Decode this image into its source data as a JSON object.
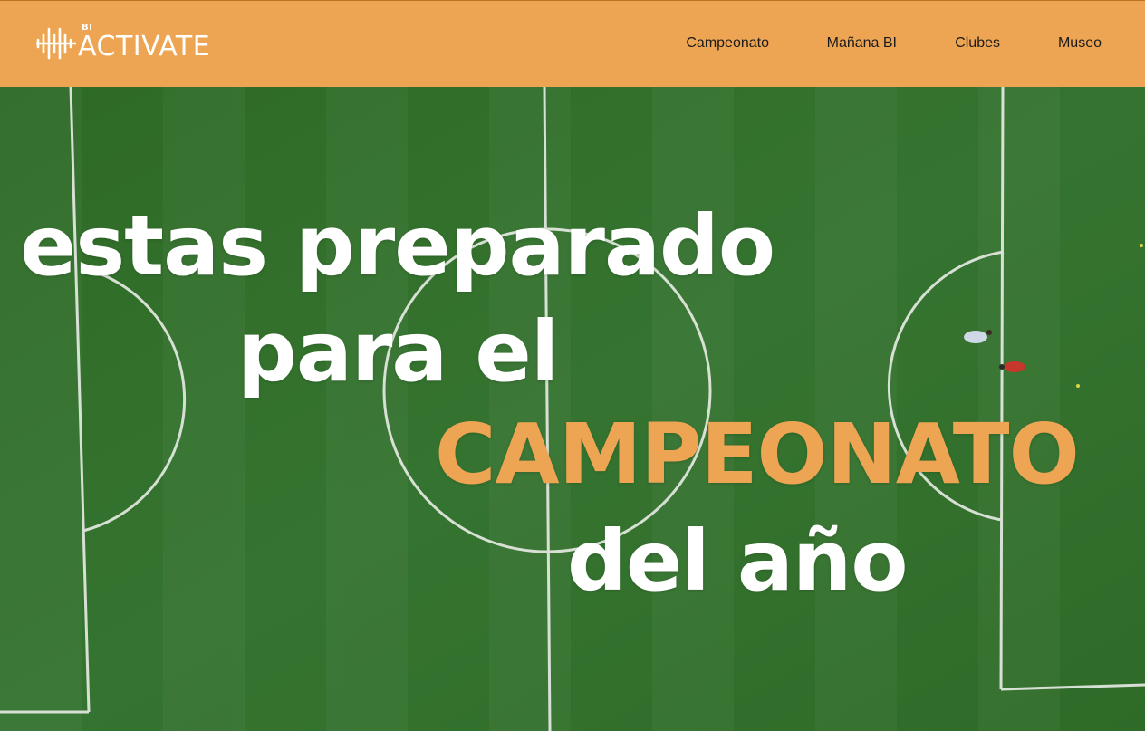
{
  "brand": {
    "superscript": "BI",
    "name": "ACTIVATE",
    "icon": "soundwave-logo-icon"
  },
  "nav": {
    "items": [
      {
        "label": "Campeonato"
      },
      {
        "label": "Mañana BI"
      },
      {
        "label": "Clubes"
      },
      {
        "label": "Museo"
      }
    ]
  },
  "hero": {
    "line1": "estas preparado",
    "line2": "para el",
    "line3": "CAMPEONATO",
    "line4": "del año",
    "background": "aerial-football-field-video"
  },
  "colors": {
    "header_bg": "#eea553",
    "accent": "#eea553",
    "text_light": "#ffffff",
    "field_green": "#2f6a28"
  }
}
